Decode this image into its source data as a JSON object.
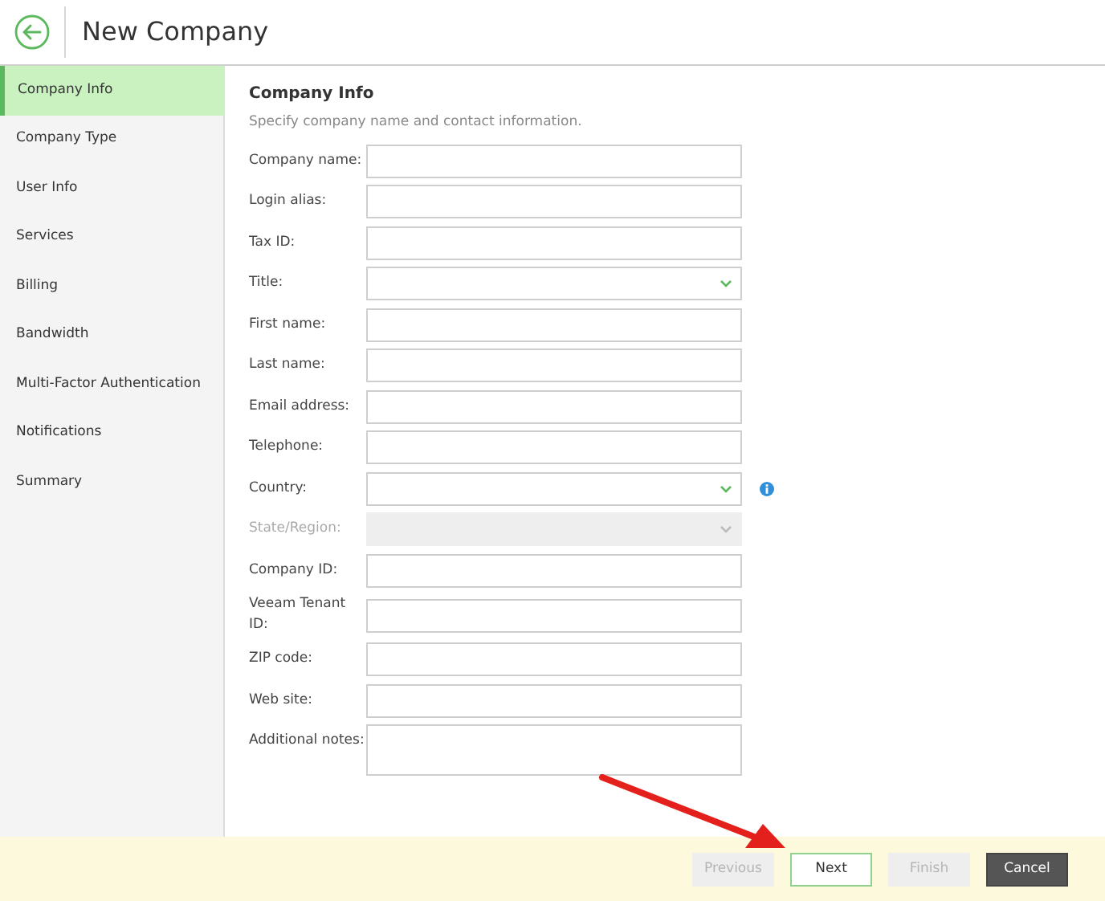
{
  "header": {
    "title": "New Company"
  },
  "sidebar": {
    "items": [
      {
        "label": "Company Info",
        "selected": true
      },
      {
        "label": "Company Type",
        "selected": false
      },
      {
        "label": "User Info",
        "selected": false
      },
      {
        "label": "Services",
        "selected": false
      },
      {
        "label": "Billing",
        "selected": false
      },
      {
        "label": "Bandwidth",
        "selected": false
      },
      {
        "label": "Multi-Factor Authentication",
        "selected": false
      },
      {
        "label": "Notifications",
        "selected": false
      },
      {
        "label": "Summary",
        "selected": false
      }
    ]
  },
  "section": {
    "title": "Company Info",
    "subtitle": "Specify company name and contact information."
  },
  "fields": [
    {
      "label": "Company name:",
      "kind": "text",
      "disabled": false
    },
    {
      "label": "Login alias:",
      "kind": "text",
      "disabled": false
    },
    {
      "label": "Tax ID:",
      "kind": "text",
      "disabled": false
    },
    {
      "label": "Title:",
      "kind": "select",
      "disabled": false
    },
    {
      "label": "First name:",
      "kind": "text",
      "disabled": false
    },
    {
      "label": "Last name:",
      "kind": "text",
      "disabled": false
    },
    {
      "label": "Email address:",
      "kind": "text",
      "disabled": false
    },
    {
      "label": "Telephone:",
      "kind": "text",
      "disabled": false
    },
    {
      "label": "Country:",
      "kind": "select",
      "disabled": false,
      "info": true
    },
    {
      "label": "State/Region:",
      "kind": "select",
      "disabled": true
    },
    {
      "label": "Company ID:",
      "kind": "text",
      "disabled": false
    },
    {
      "label": "Veeam Tenant ID:",
      "kind": "text",
      "disabled": false
    },
    {
      "label": "ZIP code:",
      "kind": "text",
      "disabled": false
    },
    {
      "label": "Web site:",
      "kind": "text",
      "disabled": false
    },
    {
      "label": "Additional notes:",
      "kind": "textarea",
      "disabled": false
    }
  ],
  "footer": {
    "buttons": [
      {
        "label": "Previous",
        "kind": "secondary",
        "disabled": true
      },
      {
        "label": "Next",
        "kind": "primary",
        "disabled": false
      },
      {
        "label": "Finish",
        "kind": "secondary",
        "disabled": true
      },
      {
        "label": "Cancel",
        "kind": "dark",
        "disabled": false
      }
    ]
  }
}
